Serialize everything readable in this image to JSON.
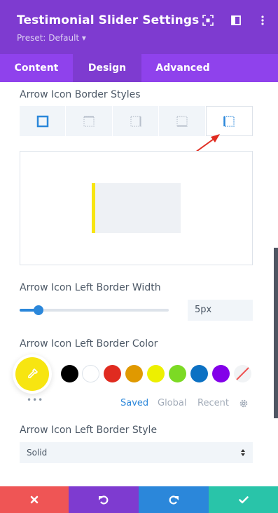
{
  "header": {
    "title": "Testimonial Slider Settings",
    "preset": "Preset: Default ▾",
    "icons": [
      "expand-icon",
      "sidebar-icon",
      "more-icon"
    ]
  },
  "tabs": [
    {
      "label": "Content",
      "active": false
    },
    {
      "label": "Design",
      "active": true
    },
    {
      "label": "Advanced",
      "active": false
    }
  ],
  "border_styles": {
    "label": "Arrow Icon Border Styles",
    "options": [
      "all-sides",
      "top",
      "right",
      "bottom",
      "left"
    ],
    "selected": "left"
  },
  "preview": {
    "border_color": "#f7e511"
  },
  "border_width": {
    "label": "Arrow Icon Left Border Width",
    "value": "5px",
    "slider_fraction": 0.13
  },
  "border_color": {
    "label": "Arrow Icon Left Border Color",
    "current": "#f7e511",
    "swatches": [
      "#000000",
      "#ffffff",
      "#e02b20",
      "#e09900",
      "#edf000",
      "#7cda24",
      "#0c71c3",
      "#8300e9",
      "transparent"
    ],
    "tabs": [
      "Saved",
      "Global",
      "Recent"
    ],
    "active_tab": "Saved",
    "dots": "•••"
  },
  "border_style": {
    "label": "Arrow Icon Left Border Style",
    "value": "Solid"
  },
  "footer": {
    "buttons": [
      {
        "name": "discard",
        "color": "#ef5555"
      },
      {
        "name": "undo",
        "color": "#7e3bd0"
      },
      {
        "name": "redo",
        "color": "#2b87da"
      },
      {
        "name": "save",
        "color": "#29c4a9"
      }
    ]
  },
  "colors": {
    "header_bg": "#7e3bd0",
    "tabs_bg": "#8f42ec",
    "accent_blue": "#2b87da",
    "annotation_arrow": "#e02b20"
  }
}
